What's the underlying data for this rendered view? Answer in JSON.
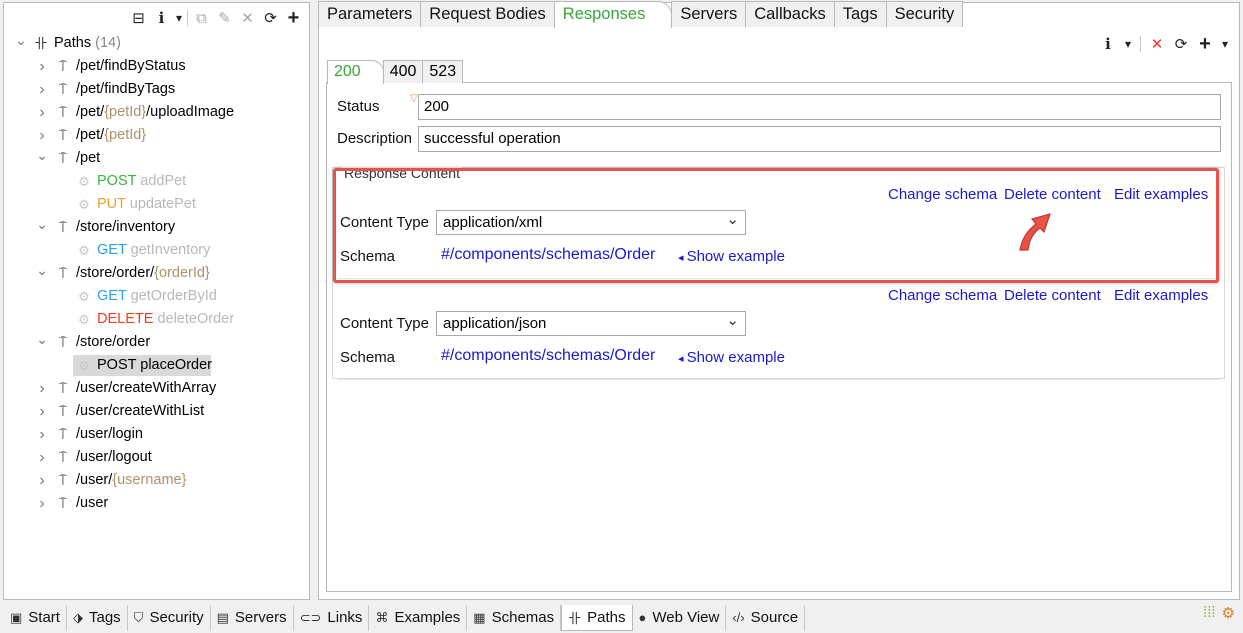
{
  "left_toolbar": {
    "collapse_icon": "⊟",
    "info_icon": "i",
    "dropdown_icon": "▾",
    "copy_icon": "⧉",
    "edit_icon": "✎",
    "delete_icon": "✕",
    "refresh_icon": "⟳",
    "add_icon": "+"
  },
  "tree": {
    "root": {
      "label": "Paths",
      "count": "(14)"
    },
    "items": [
      {
        "kind": "path",
        "parts": [
          "/pet/findByStatus"
        ]
      },
      {
        "kind": "path",
        "parts": [
          "/pet/findByTags"
        ]
      },
      {
        "kind": "path",
        "parts": [
          "/pet/",
          "{petId}",
          "/uploadImage"
        ]
      },
      {
        "kind": "path",
        "parts": [
          "/pet/",
          "{petId}"
        ]
      },
      {
        "kind": "path",
        "parts": [
          "/pet"
        ],
        "expanded": true
      },
      {
        "kind": "op",
        "method": "POST",
        "name": "addPet"
      },
      {
        "kind": "op",
        "method": "PUT",
        "name": "updatePet"
      },
      {
        "kind": "path",
        "parts": [
          "/store/inventory"
        ],
        "expanded": true
      },
      {
        "kind": "op",
        "method": "GET",
        "name": "getInventory"
      },
      {
        "kind": "path",
        "parts": [
          "/store/order/",
          "{orderId}"
        ],
        "expanded": true
      },
      {
        "kind": "op",
        "method": "GET",
        "name": "getOrderById"
      },
      {
        "kind": "op",
        "method": "DELETE",
        "name": "deleteOrder"
      },
      {
        "kind": "path",
        "parts": [
          "/store/order"
        ],
        "expanded": true
      },
      {
        "kind": "op",
        "method": "POST",
        "name": "placeOrder",
        "selected": true
      },
      {
        "kind": "path",
        "parts": [
          "/user/createWithArray"
        ]
      },
      {
        "kind": "path",
        "parts": [
          "/user/createWithList"
        ]
      },
      {
        "kind": "path",
        "parts": [
          "/user/login"
        ]
      },
      {
        "kind": "path",
        "parts": [
          "/user/logout"
        ]
      },
      {
        "kind": "path",
        "parts": [
          "/user/",
          "{username}"
        ]
      },
      {
        "kind": "path",
        "parts": [
          "/user"
        ]
      }
    ]
  },
  "tabs": [
    "Parameters",
    "Request Bodies",
    "Responses",
    "Servers",
    "Callbacks",
    "Tags",
    "Security"
  ],
  "active_tab": "Responses",
  "right_toolbar": {
    "info_icon": "i",
    "dropdown_icon": "▾",
    "delete_icon": "✕",
    "refresh_icon": "⟳",
    "add_icon": "+"
  },
  "response_tabs": [
    "200",
    "400",
    "523"
  ],
  "active_response_tab": "200",
  "form": {
    "status_label": "Status",
    "status_value": "200",
    "description_label": "Description",
    "description_value": "successful operation",
    "response_content_title": "Response Content"
  },
  "contents": [
    {
      "links": [
        "Change schema",
        "Delete content",
        "Edit examples"
      ],
      "content_type_label": "Content Type",
      "content_type_value": "application/xml",
      "schema_label": "Schema",
      "schema_value": "#/components/schemas/Order",
      "show_example": "Show example"
    },
    {
      "links": [
        "Change schema",
        "Delete content",
        "Edit examples"
      ],
      "content_type_label": "Content Type",
      "content_type_value": "application/json",
      "schema_label": "Schema",
      "schema_value": "#/components/schemas/Order",
      "show_example": "Show example"
    }
  ],
  "bottom_tabs": [
    {
      "label": "Start",
      "icon": "▣"
    },
    {
      "label": "Tags",
      "icon": "⬗"
    },
    {
      "label": "Security",
      "icon": "⛉"
    },
    {
      "label": "Servers",
      "icon": "▤"
    },
    {
      "label": "Links",
      "icon": "⊂⊃"
    },
    {
      "label": "Examples",
      "icon": "⌘"
    },
    {
      "label": "Schemas",
      "icon": "▦"
    },
    {
      "label": "Paths",
      "icon": "卝"
    },
    {
      "label": "Web View",
      "icon": "●"
    },
    {
      "label": "Source",
      "icon": "‹/›"
    }
  ],
  "active_bottom_tab": "Paths",
  "colors": {
    "accent_green": "#3aa53a",
    "link_blue": "#1a1acc",
    "highlight_red": "#e8524a"
  }
}
